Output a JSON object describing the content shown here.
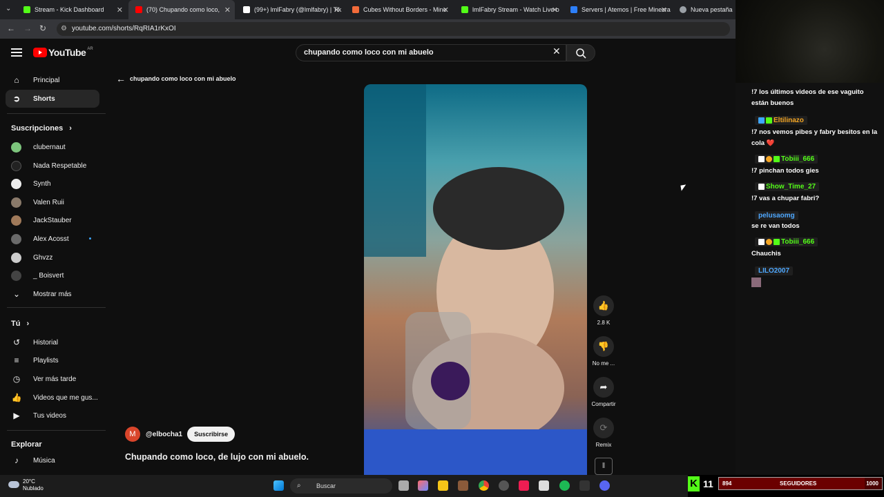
{
  "browser": {
    "tabs": [
      {
        "title": "Stream - Kick Dashboard",
        "color": "#53fc18"
      },
      {
        "title": "(70) Chupando como loco, ",
        "color": "#ff0000"
      },
      {
        "title": "(99+) lmlFabry (@lmlfabry) | Tik",
        "color": "#ffffff"
      },
      {
        "title": "Cubes Without Borders - Mine",
        "color": "#f26b3a"
      },
      {
        "title": "lmlFabry Stream - Watch Live o",
        "color": "#53fc18"
      },
      {
        "title": "Servers | Atemos | Free Minecra",
        "color": "#2d7ff9"
      },
      {
        "title": "Nueva pestaña",
        "color": "#9aa0a6"
      }
    ],
    "url": "youtube.com/shorts/RqRIA1rKxOI"
  },
  "header": {
    "logo_text": "YouTube",
    "country": "AR",
    "search_value": "chupando como loco con mi abuelo"
  },
  "sidebar": {
    "main": [
      {
        "label": "Principal",
        "icon": "home-icon"
      },
      {
        "label": "Shorts",
        "icon": "shorts-icon"
      }
    ],
    "subs_title": "Suscripciones",
    "subs": [
      {
        "label": "clubernaut",
        "color": "#7cc47c"
      },
      {
        "label": "Nada Respetable",
        "color": "#111111"
      },
      {
        "label": "Synth",
        "color": "#eeeeee"
      },
      {
        "label": "Valen Ruii",
        "color": "#8a7a6a"
      },
      {
        "label": "JackStauber",
        "color": "#a07a5a"
      },
      {
        "label": "Alex Acosst",
        "color": "#6a6a6a"
      },
      {
        "label": "Ghvzz",
        "color": "#cccccc"
      },
      {
        "label": "_ Boisvert",
        "color": "#444444"
      }
    ],
    "show_more": "Mostrar más",
    "you_title": "Tú",
    "you": [
      {
        "label": "Historial",
        "icon": "history-icon"
      },
      {
        "label": "Playlists",
        "icon": "playlist-icon"
      },
      {
        "label": "Ver más tarde",
        "icon": "clock-icon"
      },
      {
        "label": "Videos que me gus...",
        "icon": "thumbs-up-icon"
      },
      {
        "label": "Tus videos",
        "icon": "video-icon"
      }
    ],
    "explore_title": "Explorar",
    "explore": [
      {
        "label": "Música",
        "icon": "music-icon"
      }
    ]
  },
  "main": {
    "back_label": "chupando como loco con mi abuelo",
    "channel_initial": "M",
    "channel_name": "@elbocha1",
    "subscribe_label": "Suscribirse",
    "caption": "Chupando como loco, de lujo con mi abuelo.",
    "actions": {
      "like_count": "2.8 K",
      "dislike_label": "No me ...",
      "share_label": "Compartir",
      "remix_label": "Remix"
    }
  },
  "chat": {
    "messages": [
      {
        "user": "",
        "text": "!7 los últimos videos de ese vaguito están buenos"
      },
      {
        "user": "Eltilinazo",
        "user_color": "#f5a623",
        "text": "!7 nos vemos pibes y fabry besitos en la cola ❤️"
      },
      {
        "user": "Tobiii_666",
        "user_color": "#53fc18",
        "text": "!7 pinchan todos gies"
      },
      {
        "user": "Show_Time_27",
        "user_color": "#53fc18",
        "text": "!7 vas a chupar fabri?"
      },
      {
        "user": "pelusaomg",
        "user_color": "#4ea8ff",
        "text": "se re van todos"
      },
      {
        "user": "Tobiii_666",
        "user_color": "#53fc18",
        "text": "Chauchis"
      },
      {
        "user": "LILO2007",
        "user_color": "#4ea8ff",
        "text": ""
      }
    ]
  },
  "taskbar": {
    "temp": "20°C",
    "weather": "Nublado",
    "search": "Buscar"
  },
  "kick": {
    "logo": "K",
    "viewers": "11",
    "goal_current": "894",
    "goal_label": "SEGUIDORES",
    "goal_total": "1000",
    "goal_fraction": 0.894
  }
}
